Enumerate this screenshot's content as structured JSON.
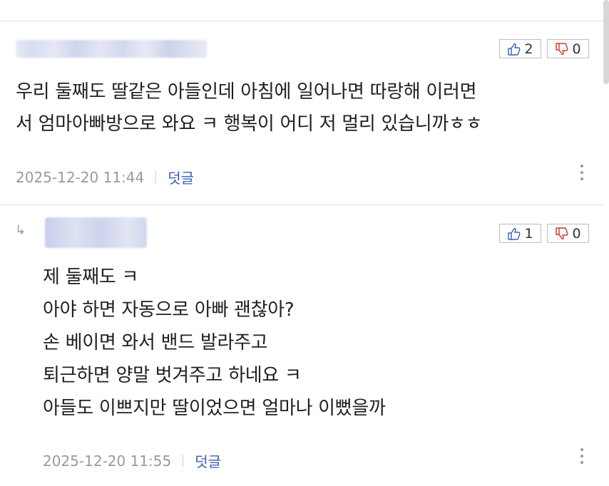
{
  "comments": [
    {
      "lines": [
        "우리 둘째도 딸같은 아들인데 아침에 일어나면 따랑해 이러면",
        "서 엄마아빠방으로 와요 ㅋ 행복이 어디 저 멀리 있습니까ㅎㅎ"
      ],
      "likes": "2",
      "dislikes": "0",
      "timestamp": "2025-12-20 11:44",
      "reply_label": "덧글"
    },
    {
      "lines": [
        "제 둘째도 ㅋ",
        "아야 하면 자동으로 아빠 괜찮아?",
        "손 베이면 와서 밴드 발라주고",
        "퇴근하면 양말 벗겨주고 하네요 ㅋ",
        "아들도 이쁘지만 딸이었으면 얼마나 이뻤을까"
      ],
      "likes": "1",
      "dislikes": "0",
      "timestamp": "2025-12-20 11:55",
      "reply_label": "덧글"
    }
  ],
  "icons": {
    "like": "thumbs-up-icon",
    "dislike": "thumbs-down-icon",
    "more": "more-vertical-icon",
    "reply_indicator": "reply-arrow-icon"
  },
  "colors": {
    "reply_link": "#3b5fb0",
    "meta_text": "#9a9a9a",
    "dislike_accent": "#d0342c"
  }
}
